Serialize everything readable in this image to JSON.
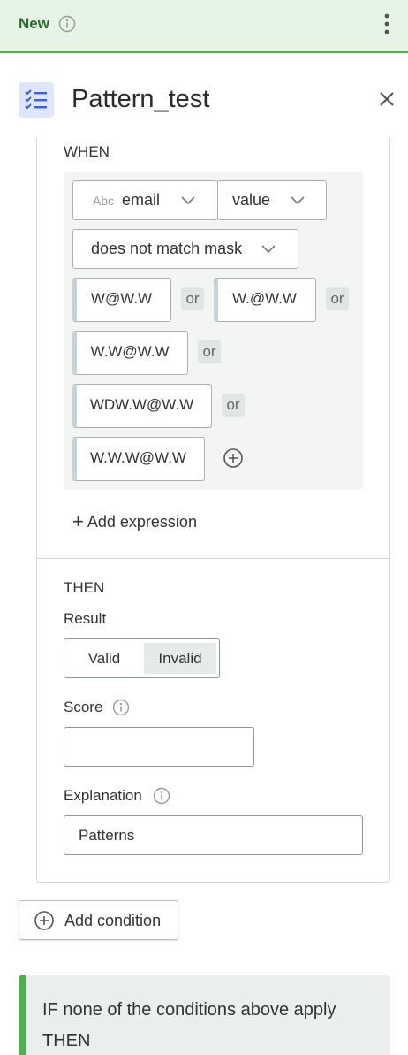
{
  "topbar": {
    "status": "New"
  },
  "header": {
    "title": "Pattern_test"
  },
  "when": {
    "label": "WHEN",
    "attribute": {
      "type_icon": "Abc",
      "name": "email"
    },
    "property": "value",
    "operator": "does not match mask",
    "values": [
      "W@W.W",
      "W.@W.W",
      "W.W@W.W",
      "WDW.W@W.W",
      "W.W.W@W.W"
    ],
    "or_label": "or",
    "add_expression": "Add expression"
  },
  "then": {
    "label": "THEN",
    "result_label": "Result",
    "result_options": [
      "Valid",
      "Invalid"
    ],
    "result_selected": "Invalid",
    "score_label": "Score",
    "score_value": "",
    "explanation_label": "Explanation",
    "explanation_value": "Patterns"
  },
  "add_condition": "Add condition",
  "otherwise": {
    "text": "IF none of the conditions above apply THEN"
  },
  "colors": {
    "accent_green": "#4caf50",
    "status_bg": "#e6f4e6",
    "logo_blue": "#3b5fd6"
  }
}
